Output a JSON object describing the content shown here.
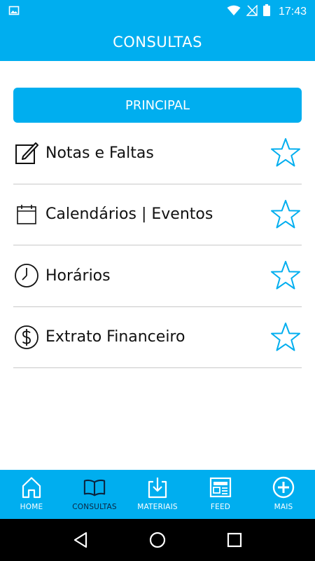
{
  "status_bar": {
    "time": "17:43",
    "icons": [
      "image-icon",
      "wifi-icon",
      "no-signal-icon",
      "battery-icon"
    ]
  },
  "header": {
    "title": "CONSULTAS"
  },
  "section": {
    "label": "PRINCIPAL"
  },
  "menu": {
    "items": [
      {
        "label": "Notas e Faltas",
        "icon": "edit-note-icon"
      },
      {
        "label": "Calendários | Eventos",
        "icon": "calendar-icon"
      },
      {
        "label": "Horários",
        "icon": "clock-icon"
      },
      {
        "label": "Extrato Financeiro",
        "icon": "dollar-icon"
      }
    ]
  },
  "bottom_nav": {
    "items": [
      {
        "label": "HOME",
        "icon": "home-icon"
      },
      {
        "label": "CONSULTAS",
        "icon": "book-icon",
        "active": true
      },
      {
        "label": "MATERIAIS",
        "icon": "download-icon"
      },
      {
        "label": "FEED",
        "icon": "news-icon"
      },
      {
        "label": "MAIS",
        "icon": "plus-circle-icon"
      }
    ]
  },
  "colors": {
    "accent": "#00aeef",
    "active_nav_text": "#0b2540"
  }
}
